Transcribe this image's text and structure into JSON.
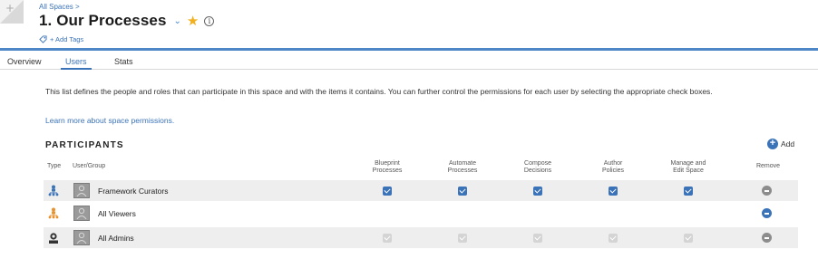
{
  "header": {
    "breadcrumb": "All Spaces >",
    "title": "1. Our Processes",
    "add_tags": "+ Add Tags"
  },
  "tabs": [
    {
      "label": "Overview",
      "active": false
    },
    {
      "label": "Users",
      "active": true
    },
    {
      "label": "Stats",
      "active": false
    }
  ],
  "content": {
    "description": "This list defines the people and roles that can participate in this space and with the items it contains. You can further control the permissions for each user by selecting the appropriate check boxes.",
    "learn_more": "Learn more about space permissions.",
    "section_title": "PARTICIPANTS",
    "add_label": "Add"
  },
  "table": {
    "columns": {
      "type": "Type",
      "user_group": "User/Group",
      "blueprint": [
        "Blueprint",
        "Processes"
      ],
      "automate": [
        "Automate",
        "Processes"
      ],
      "compose": [
        "Compose",
        "Decisions"
      ],
      "author": [
        "Author",
        "Policies"
      ],
      "manage": [
        "Manage and",
        "Edit Space"
      ],
      "remove": "Remove"
    },
    "rows": [
      {
        "name": "Framework Curators",
        "type_icon": "group-blue-icon",
        "permissions": [
          true,
          true,
          true,
          true,
          true
        ],
        "editable": true,
        "remove_style": "grey"
      },
      {
        "name": "All Viewers",
        "type_icon": "group-orange-icon",
        "permissions": [
          false,
          false,
          false,
          false,
          false
        ],
        "editable": true,
        "remove_style": "blue"
      },
      {
        "name": "All Admins",
        "type_icon": "admin-icon",
        "permissions": [
          true,
          true,
          true,
          true,
          true
        ],
        "editable": false,
        "remove_style": "grey"
      }
    ]
  },
  "colors": {
    "accent": "#3b73b9",
    "star": "#f2b01e",
    "header_line": "#4d87c8"
  }
}
